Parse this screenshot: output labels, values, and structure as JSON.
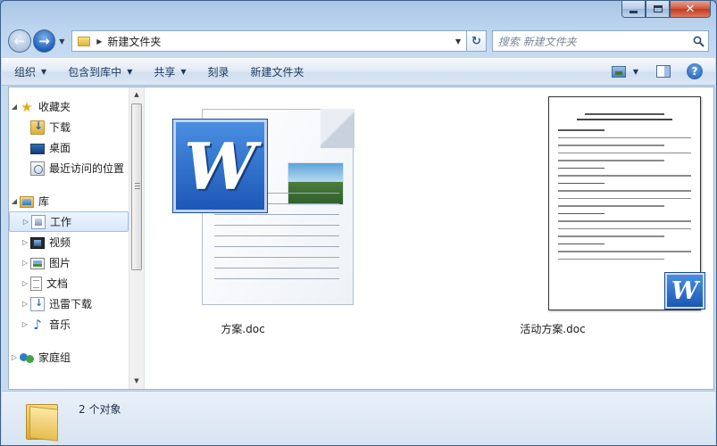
{
  "window": {
    "caption": {
      "minimize": "",
      "maximize": "",
      "close": "✕"
    }
  },
  "nav": {
    "back_glyph": "←",
    "forward_glyph": "→",
    "address_path": "新建文件夹",
    "search_placeholder": "搜索 新建文件夹"
  },
  "toolbar": {
    "organize": "组织",
    "include_in_library": "包含到库中",
    "share": "共享",
    "burn": "刻录",
    "new_folder": "新建文件夹",
    "help": "?"
  },
  "sidebar": {
    "favorites_label": "收藏夹",
    "favorites": [
      "下载",
      "桌面",
      "最近访问的位置"
    ],
    "libraries_label": "库",
    "libraries": [
      "工作",
      "视频",
      "图片",
      "文档",
      "迅雷下载",
      "音乐"
    ],
    "selected": "工作",
    "homegroup_label": "家庭组"
  },
  "files": [
    {
      "name": "方案.doc",
      "icon": "word-document-icon"
    },
    {
      "name": "活动方案.doc",
      "icon": "word-document-thumbnail"
    }
  ],
  "details": {
    "count": "2 个对象"
  }
}
